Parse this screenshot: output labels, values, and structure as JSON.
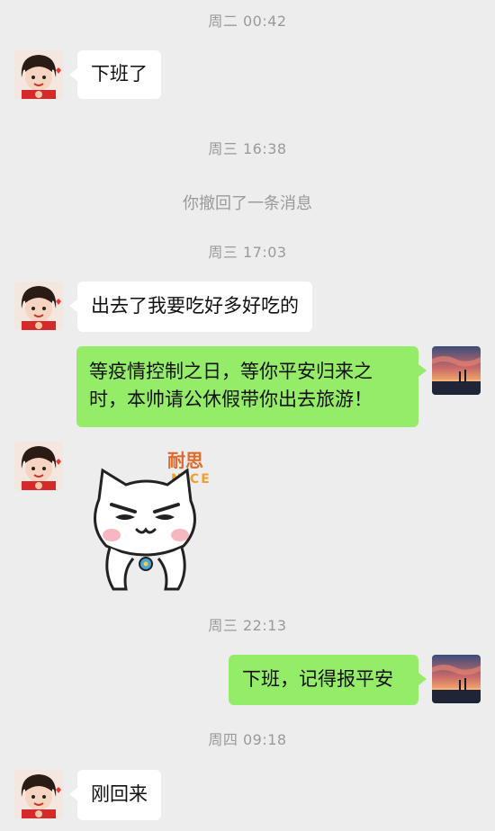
{
  "messages": {
    "ts1": "周二 00:42",
    "m1": "下班了",
    "ts2": "周三 16:38",
    "recall": "你撤回了一条消息",
    "ts3": "周三 17:03",
    "m2": "出去了我要吃好多好吃的",
    "m3_line1": "等疫情控制之日，等你平安归来之",
    "m3_line2": "时，本帅请公休假带你出去旅游！",
    "sticker_text_cn": "耐思",
    "sticker_text_en": "NICE",
    "ts4": "周三 22:13",
    "m4": "下班，记得报平安",
    "ts5": "周四 09:18",
    "m5": "刚回来"
  },
  "colors": {
    "background": "#ededed",
    "left_bubble": "#ffffff",
    "right_bubble": "#95ec69",
    "timestamp": "#9a9a9a"
  },
  "icons": {
    "left_avatar": "girl-avatar-icon",
    "right_avatar": "sunset-avatar-icon",
    "sticker": "nice-cat-sticker-icon"
  }
}
